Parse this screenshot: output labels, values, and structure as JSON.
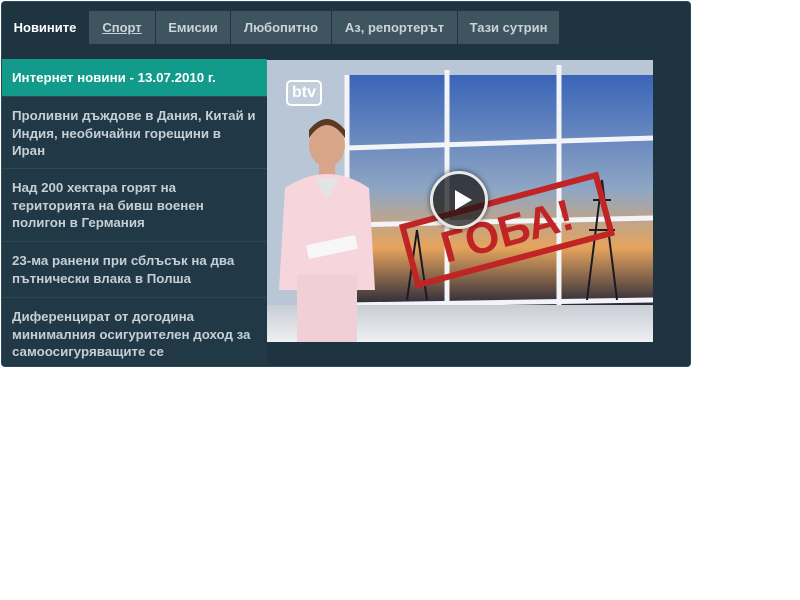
{
  "tabs": [
    {
      "label": "Новините",
      "active": true
    },
    {
      "label": "Спорт",
      "active": false
    },
    {
      "label": "Емисии",
      "active": false
    },
    {
      "label": "Любопитно",
      "active": false
    },
    {
      "label": "Аз, репортерът",
      "active": false
    },
    {
      "label": "Тази сутрин",
      "active": false
    }
  ],
  "news": [
    {
      "title": "Интернет новини - 13.07.2010 г.",
      "active": true
    },
    {
      "title": "Проливни дъждове в Дания, Китай и Индия, необичайни горещини в Иран"
    },
    {
      "title": "Над 200 хектара горят на територията на бивш военен полигон в Германия"
    },
    {
      "title": "23-ма ранени при сблъсък на два пътнически влака в Полша"
    },
    {
      "title": "Диференцират от догодина минималния осигурителен доход за самоосигуряващите се"
    }
  ],
  "video": {
    "logo": "btv",
    "banner_text": "ГОБА!"
  },
  "colors": {
    "panel": "#1e3441",
    "tab_inactive": "#3e5560",
    "active_item": "#129b8b"
  },
  "icons": {
    "play": "play-icon",
    "logo": "btv-logo"
  }
}
